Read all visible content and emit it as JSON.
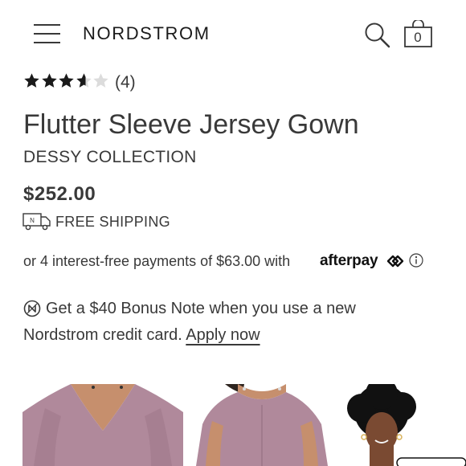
{
  "header": {
    "logo": "NORDSTROM",
    "cart_count": "0"
  },
  "product": {
    "rating": 4,
    "rating_text": "(4)",
    "title": "Flutter Sleeve Jersey Gown",
    "brand": "DESSY COLLECTION",
    "price": "$252.00",
    "shipping": "FREE SHIPPING",
    "installments_text": "or 4 interest-free payments of $63.00 with",
    "afterpay_label": "afterpay",
    "promo_line1": "Get a $40 Bonus Note when you use a new",
    "promo_line2": "Nordstrom credit card.",
    "promo_link": "Apply now"
  },
  "colors": {
    "text": "#393939",
    "dress": "#b0899b",
    "skin": "#c68f6d"
  },
  "icons": [
    "menu-icon",
    "search-icon",
    "shopping-bag-icon",
    "star-icon",
    "truck-icon",
    "afterpay-icon",
    "info-icon",
    "bonus-note-icon"
  ]
}
